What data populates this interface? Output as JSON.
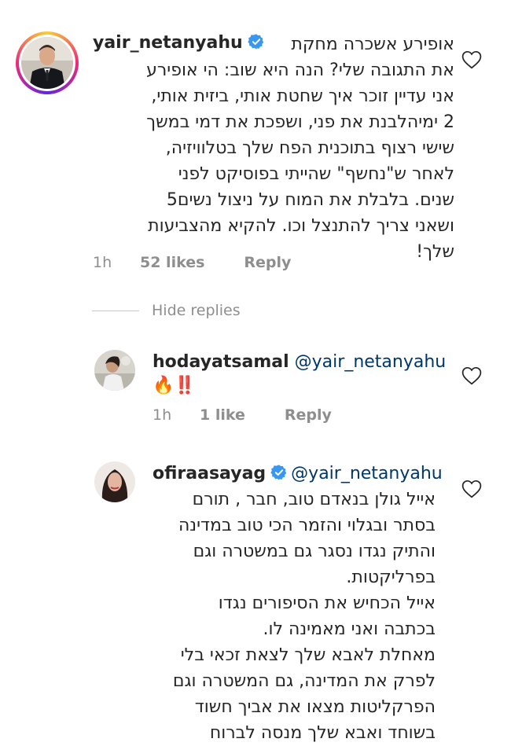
{
  "colors": {
    "mention": "#00376b",
    "meta_gray": "#8e8e8e",
    "text": "#262626",
    "verified_blue": "#3897f0"
  },
  "comments": [
    {
      "username": "yair_netanyahu",
      "verified": true,
      "lines": [
        "אופירע אשכרה מחקת",
        "את התגובה שלי? הנה היא שוב: הי אופירע",
        "אני עדיין זוכר איך שחטת אותי, ביזית אותי,",
        "2 ימיהלבנת את פני, ושפכת את דמי במשך",
        "שישי רצוף בתוכנית הפח שלך בטלוויזיה,",
        "לאחר ש\"נחשף\" שהייתי בפוסיקט לפני",
        "שנים. בלבלת את המוח על ניצול נשים5",
        "ושאני צריך להתנצל וכו. להקיא מהצביעות",
        "שלך!"
      ],
      "time": "1h",
      "likes": "52 likes",
      "reply_label": "Reply"
    }
  ],
  "hide_replies_label": "Hide replies",
  "replies": [
    {
      "username": "hodayatsamal",
      "verified": false,
      "mention": "@yair_netanyahu",
      "emoji_text": "🔥‼️",
      "time": "1h",
      "likes": "1 like",
      "reply_label": "Reply"
    },
    {
      "username": "ofiraasayag",
      "verified": true,
      "mention": "@yair_netanyahu",
      "lines": [
        "אייל גולן בנאדם טוב, חבר , תורם",
        "בסתר ובגלוי והזמר הכי טוב במדינה",
        "והתיק נגדו נסגר גם במשטרה וגם",
        "בפרליקטות.",
        "אייל הכחיש את הסיפורים נגדו",
        "בכתבה ואני מאמינה לו.",
        "מאחלת לאבא שלך לצאת זכאי בלי",
        "לפרק את המדינה, גם המשטרה וגם",
        "הפרקליטות מצאו את אביך חשוד",
        "בשוחד ואבא שלך מנסה לברוח"
      ]
    }
  ]
}
